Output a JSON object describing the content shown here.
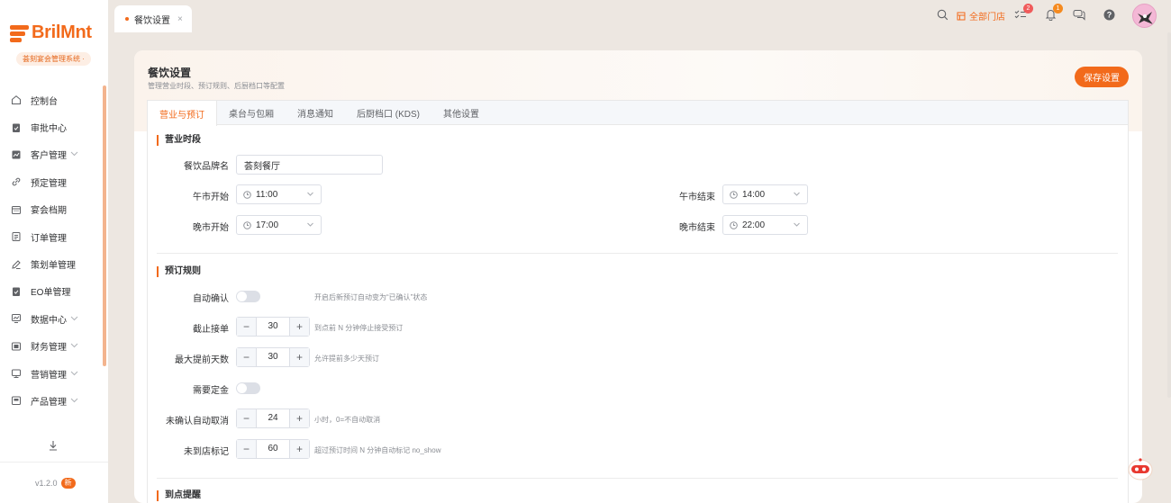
{
  "brand": {
    "name": "BrilMnt",
    "system": "荟刻宴会管理系统 ·"
  },
  "sidebar": {
    "items": [
      {
        "label": "控制台",
        "icon": "home-icon",
        "expandable": false
      },
      {
        "label": "审批中心",
        "icon": "clipboard-check-icon",
        "expandable": false
      },
      {
        "label": "客户管理",
        "icon": "chart-card-icon",
        "expandable": true
      },
      {
        "label": "预定管理",
        "icon": "link-icon",
        "expandable": false
      },
      {
        "label": "宴会档期",
        "icon": "calendar-icon",
        "expandable": false
      },
      {
        "label": "订单管理",
        "icon": "document-icon",
        "expandable": false
      },
      {
        "label": "策划单管理",
        "icon": "pen-icon",
        "expandable": false
      },
      {
        "label": "EO单管理",
        "icon": "clipboard-list-icon",
        "expandable": false
      },
      {
        "label": "数据中心",
        "icon": "chart-board-icon",
        "expandable": true
      },
      {
        "label": "财务管理",
        "icon": "finance-icon",
        "expandable": true
      },
      {
        "label": "营销管理",
        "icon": "monitor-icon",
        "expandable": true
      },
      {
        "label": "产品管理",
        "icon": "product-icon",
        "expandable": true
      }
    ],
    "version": "v1.2.0",
    "new_badge": "新"
  },
  "topbar": {
    "tab_label": "餐饮设置",
    "store_label": "全部门店",
    "task_count": "2",
    "notify_count": "1"
  },
  "page": {
    "title": "餐饮设置",
    "subtitle": "管理营业时段、预订规则、后厨档口等配置",
    "save_label": "保存设置"
  },
  "tabs": [
    "营业与预订",
    "桌台与包厢",
    "消息通知",
    "后厨档口 (KDS)",
    "其他设置"
  ],
  "business_hours": {
    "title": "营业时段",
    "brand_label": "餐饮品牌名",
    "brand_value": "荟刻餐厅",
    "lunch_start_label": "午市开始",
    "lunch_start": "11:00",
    "lunch_end_label": "午市结束",
    "lunch_end": "14:00",
    "dinner_start_label": "晚市开始",
    "dinner_start": "17:00",
    "dinner_end_label": "晚市结束",
    "dinner_end": "22:00"
  },
  "booking_rules": {
    "title": "预订规则",
    "auto_confirm_label": "自动确认",
    "auto_confirm_hint": "开启后新预订自动变为“已确认”状态",
    "cutoff_label": "截止接单",
    "cutoff_value": "30",
    "cutoff_hint": "到点前 N 分钟停止接受预订",
    "max_days_label": "最大提前天数",
    "max_days_value": "30",
    "max_days_hint": "允许提前多少天预订",
    "deposit_label": "需要定金",
    "auto_cancel_label": "未确认自动取消",
    "auto_cancel_value": "24",
    "auto_cancel_hint": "小时，0=不自动取消",
    "no_show_label": "未到店标记",
    "no_show_value": "60",
    "no_show_hint": "超过预订时间 N 分钟自动标记 no_show"
  },
  "arrival_reminder": {
    "title": "到点提醒"
  },
  "colors": {
    "accent": "#f26a1b",
    "background": "#ede7e1"
  }
}
